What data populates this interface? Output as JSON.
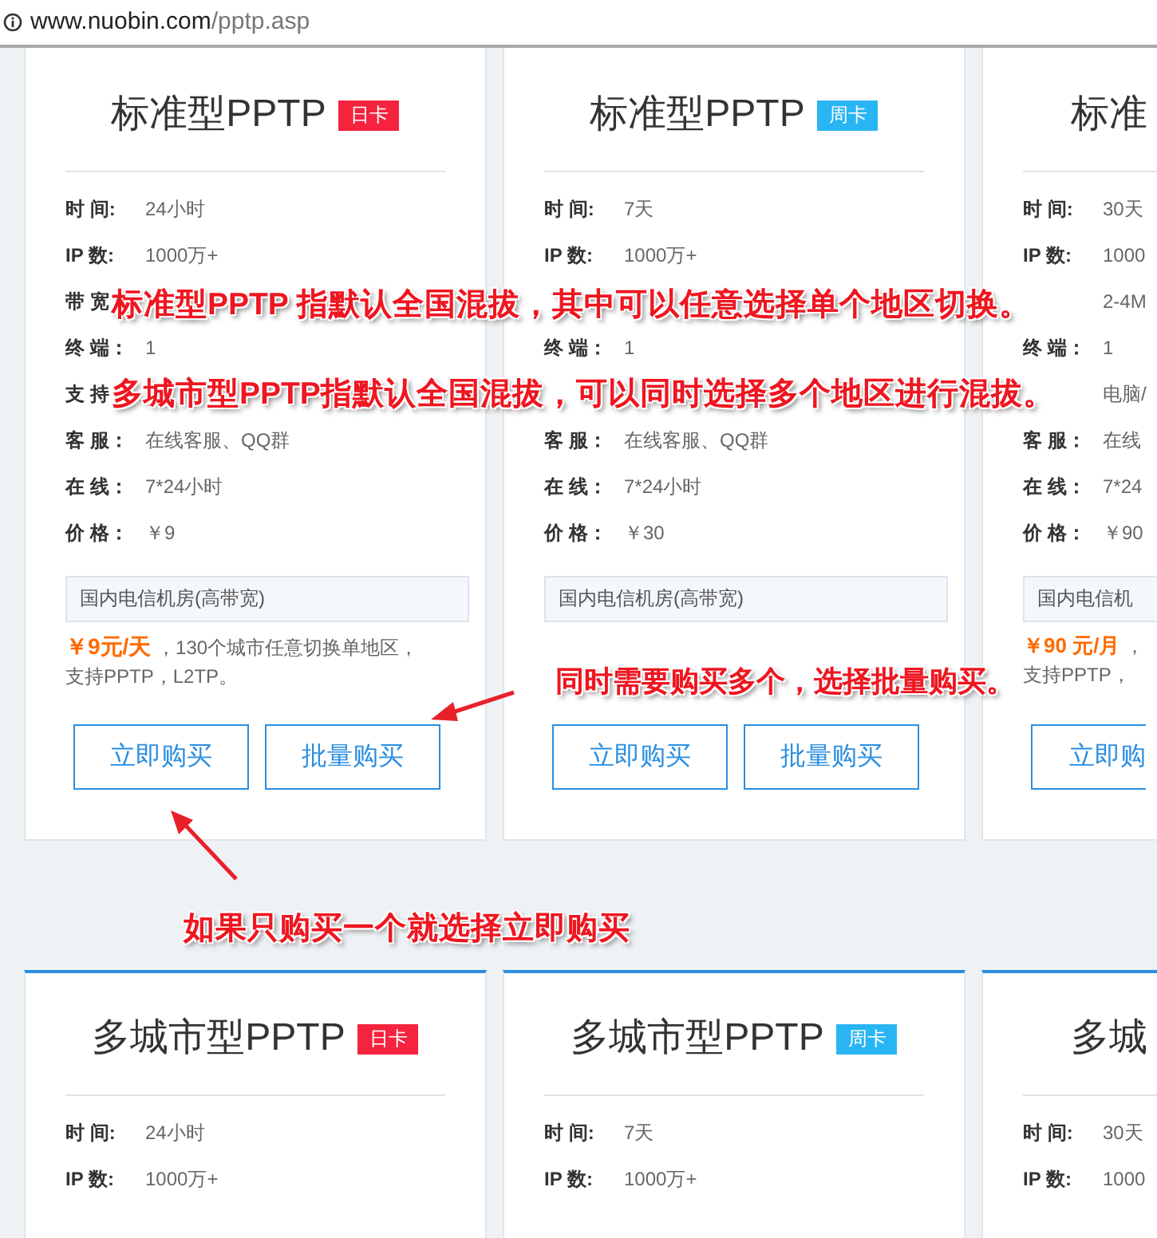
{
  "address_bar": {
    "host": "www.nuobin.com",
    "path": "/pptp.asp"
  },
  "card_rows": [
    {
      "cards": [
        {
          "title": "标准型PPTP",
          "badge": {
            "text": "日卡",
            "color": "#f5233e"
          },
          "clipped": false,
          "specs": [
            {
              "label": "时 间:",
              "value": "24小时"
            },
            {
              "label": "IP 数:",
              "value": "1000万+"
            },
            {
              "label": "带 宽"
            },
            {
              "label": "终 端：",
              "value": "1"
            },
            {
              "label": "支 持"
            },
            {
              "label": "客 服：",
              "value": "在线客服、QQ群"
            },
            {
              "label": "在 线：",
              "value": "7*24小时"
            },
            {
              "label": "价 格：",
              "value": "￥9"
            }
          ],
          "location_box": "国内电信机房(高带宽)",
          "price_note": {
            "price": "￥9元/天",
            "text": " ，130个城市任意切换单地区，支持PPTP，L2TP。"
          },
          "buttons": [
            "立即购买",
            "批量购买"
          ]
        },
        {
          "title": "标准型PPTP",
          "badge": {
            "text": "周卡",
            "color": "#29b5f2"
          },
          "clipped": false,
          "specs": [
            {
              "label": "时 间:",
              "value": "7天"
            },
            {
              "label": "IP 数:",
              "value": "1000万+"
            },
            {
              "kind": "covered"
            },
            {
              "label": "终 端：",
              "value": "1"
            },
            {
              "kind": "covered"
            },
            {
              "label": "客 服：",
              "value": "在线客服、QQ群"
            },
            {
              "label": "在 线：",
              "value": "7*24小时"
            },
            {
              "label": "价 格：",
              "value": "￥30"
            }
          ],
          "location_box": "国内电信机房(高带宽)",
          "buttons": [
            "立即购买",
            "批量购买"
          ]
        },
        {
          "title": "标准",
          "clipped": true,
          "specs": [
            {
              "label": "时 间:",
              "value": "30天"
            },
            {
              "label": "IP 数:",
              "value": "1000"
            },
            {
              "value": "2-4M"
            },
            {
              "label": "终 端：",
              "value": "1"
            },
            {
              "value": "电脑/"
            },
            {
              "label": "客 服：",
              "value": "在线"
            },
            {
              "label": "在 线：",
              "value": "7*24"
            },
            {
              "label": "价 格：",
              "value": "￥90"
            }
          ],
          "location_box": "国内电信机",
          "price_note": {
            "price": "￥90 元/月",
            "text": " ，支持PPTP，"
          },
          "buttons": [
            "立即购"
          ]
        }
      ]
    },
    {
      "cards": [
        {
          "title": "多城市型PPTP",
          "badge": {
            "text": "日卡",
            "color": "#f5233e"
          },
          "clipped": false,
          "specs": [
            {
              "label": "时 间:",
              "value": "24小时"
            },
            {
              "label": "IP 数:",
              "value": "1000万+"
            }
          ]
        },
        {
          "title": "多城市型PPTP",
          "badge": {
            "text": "周卡",
            "color": "#29b5f2"
          },
          "clipped": false,
          "specs": [
            {
              "label": "时 间:",
              "value": "7天"
            },
            {
              "label": "IP 数:",
              "value": "1000万+"
            }
          ]
        },
        {
          "title": "多城",
          "clipped": true,
          "specs": [
            {
              "label": "时 间:",
              "value": "30天"
            },
            {
              "label": "IP 数:",
              "value": "1000"
            }
          ]
        }
      ]
    }
  ],
  "annotations": [
    {
      "text": "标准型PPTP 指默认全国混拔，其中可以任意选择单个地区切换。"
    },
    {
      "text": "多城市型PPTP指默认全国混拔，可以同时选择多个地区进行混拔。"
    },
    {
      "text": "同时需要购买多个，选择批量购买。"
    },
    {
      "text": "如果只购买一个就选择立即购买"
    }
  ]
}
